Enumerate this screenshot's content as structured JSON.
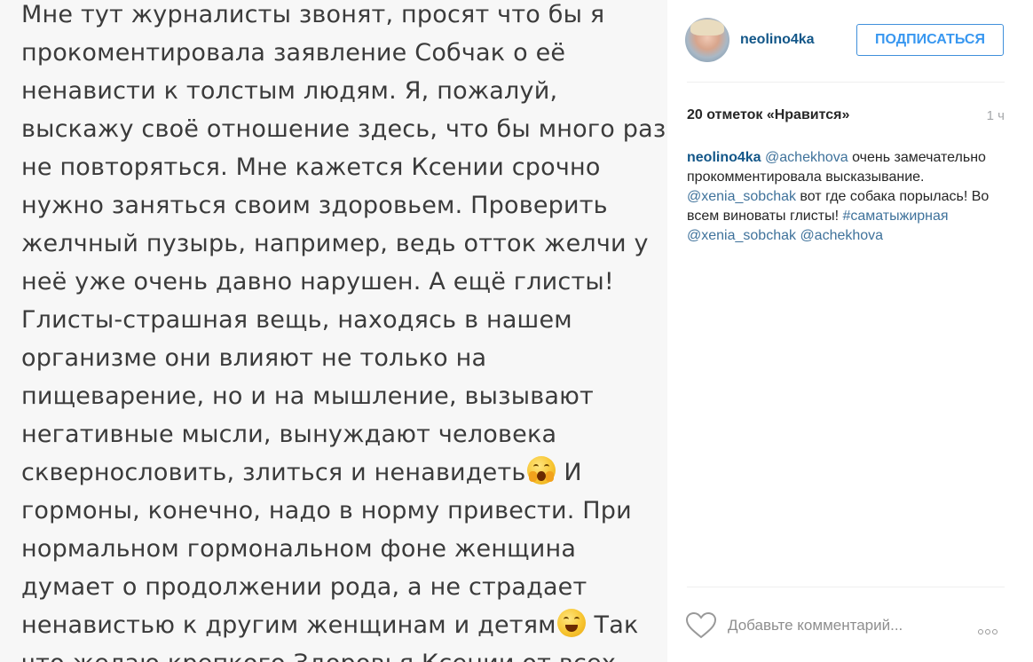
{
  "post_image": {
    "text_lines": [
      "Мне тут журналисты звонят, просят что бы я",
      "прокоментировала заявление Собчак о её",
      "ненависти к толстым людям. Я, пожалуй,",
      "выскажу своё отношение здесь, что бы много раз",
      "не повторяться. Мне кажется Ксении срочно",
      "нужно заняться своим здоровьем. Проверить",
      "желчный пузырь, например, ведь отток желчи у",
      "неё уже очень давно нарушен. А ещё глисты!",
      "Глисты-страшная вещь, находясь в нашем",
      "организме они влияют не только на",
      "пищеварение, но и на мышление, вызывают",
      "негативные мысли, вынуждают человека",
      "скверносло­вить, злиться и ненавидеть",
      "И",
      "гормоны, конечно, надо в норму привести. При",
      "нормальном гормональном фоне женщина",
      "думает о продолжении рода, а не страдает",
      "ненавистью к другим женщинам и детям",
      "Так",
      "что желаю крепкого Здоровья Ксении от всех"
    ],
    "emoji_1": "screaming-face-emoji",
    "emoji_2": "grinning-face-emoji"
  },
  "header": {
    "username": "neolino4ka",
    "follow_label": "ПОДПИСАТЬСЯ"
  },
  "stats": {
    "likes": "20 отметок «Нравится»",
    "time": "1 ч"
  },
  "caption": {
    "author": "neolino4ka",
    "mention_1": "@achekhova",
    "text_1": " очень замечательно прокомментировала высказывание. ",
    "mention_2": "@xenia_sobchak",
    "text_2": " вот где собака порылась! Во всем виноваты глисты! ",
    "hashtag": "#саматыжирная",
    "mention_3": "@xenia_sobchak",
    "mention_4": "@achekhova"
  },
  "comment": {
    "placeholder": "Добавьте комментарий..."
  },
  "colors": {
    "link": "#125688",
    "mention": "#3f729b",
    "button": "#3897f0"
  }
}
